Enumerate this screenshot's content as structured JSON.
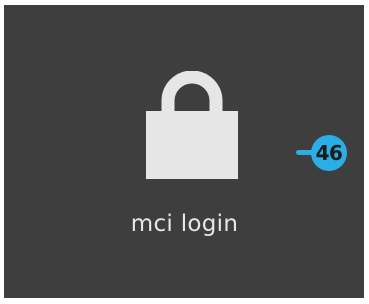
{
  "tile": {
    "label": "mci login",
    "icon": "lock-icon",
    "background_color": "#3e3e3e"
  },
  "badge": {
    "value": "46",
    "color": "#29aee6"
  }
}
